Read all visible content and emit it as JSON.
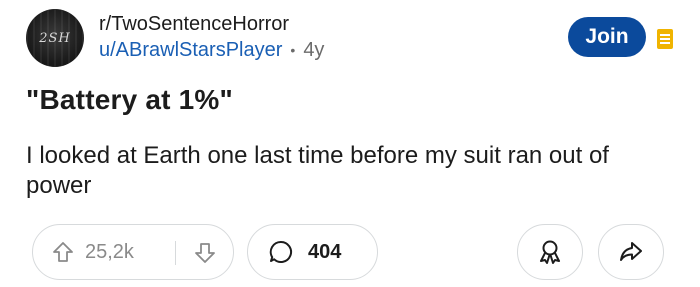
{
  "header": {
    "avatar_text": "2SH",
    "subreddit": "r/TwoSentenceHorror",
    "username": "u/ABrawlStarsPlayer",
    "separator": "•",
    "age": "4y",
    "join_label": "Join"
  },
  "post": {
    "title": "\"Battery at 1%\"",
    "body": "I looked at Earth one last time before my suit ran out of power"
  },
  "actions": {
    "upvotes": "25,2k",
    "comments": "404"
  },
  "colors": {
    "join_bg": "#0b4a9c",
    "username": "#1a5fb4",
    "menu_icon": "#f0b400"
  },
  "icons": {
    "upvote": "arrow-up-outline",
    "downvote": "arrow-down-outline",
    "comment": "speech-bubble",
    "award": "award-ribbon",
    "share": "share-arrow",
    "menu": "filter-lines"
  }
}
